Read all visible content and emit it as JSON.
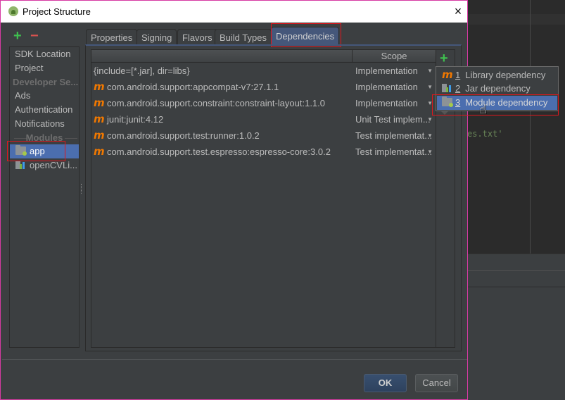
{
  "background_editor": {
    "code_fragment": "es.txt'"
  },
  "dialog": {
    "title": "Project Structure",
    "close_icon": "×",
    "toolbar": {
      "add_icon": "+",
      "remove_icon": "−"
    },
    "sidebar": {
      "items": [
        {
          "label": "SDK Location",
          "type": "item"
        },
        {
          "label": "Project",
          "type": "item"
        },
        {
          "label": "Developer Se...",
          "type": "header"
        },
        {
          "label": "Ads",
          "type": "item"
        },
        {
          "label": "Authentication",
          "type": "item"
        },
        {
          "label": "Notifications",
          "type": "item"
        },
        {
          "label": "Modules",
          "type": "separator"
        },
        {
          "label": "app",
          "type": "module",
          "icon": "module-folder-icon",
          "selected": true
        },
        {
          "label": "openCVLi...",
          "type": "module",
          "icon": "library-module-icon",
          "selected": false
        }
      ]
    },
    "tabs": [
      {
        "label": "Properties",
        "active": false
      },
      {
        "label": "Signing",
        "active": false
      },
      {
        "label": "Flavors",
        "active": false
      },
      {
        "label": "Build Types",
        "active": false
      },
      {
        "label": "Dependencies",
        "active": true
      }
    ],
    "dependencies_table": {
      "columns": [
        "",
        "Scope"
      ],
      "rows": [
        {
          "name": "{include=[*.jar], dir=libs}",
          "icon": "",
          "scope": "Implementation"
        },
        {
          "name": "com.android.support:appcompat-v7:27.1.1",
          "icon": "maven-icon",
          "scope": "Implementation"
        },
        {
          "name": "com.android.support.constraint:constraint-layout:1.1.0",
          "icon": "maven-icon",
          "scope": "Implementation"
        },
        {
          "name": "junit:junit:4.12",
          "icon": "maven-icon",
          "scope": "Unit Test implem..."
        },
        {
          "name": "com.android.support.test:runner:1.0.2",
          "icon": "maven-icon",
          "scope": "Test implementat..."
        },
        {
          "name": "com.android.support.test.espresso:espresso-core:3.0.2",
          "icon": "maven-icon",
          "scope": "Test implementat..."
        }
      ],
      "maven_glyph": "m",
      "dropdown_glyph": "▼"
    },
    "add_dependency_icon": "+",
    "add_menu": {
      "items": [
        {
          "mnemonic": "1",
          "label": "Library dependency",
          "icon": "maven-icon",
          "selected": false
        },
        {
          "mnemonic": "2",
          "label": "Jar dependency",
          "icon": "jar-icon",
          "selected": false
        },
        {
          "mnemonic": "3",
          "label": "Module dependency",
          "icon": "module-folder-icon",
          "selected": true
        }
      ]
    },
    "buttons": {
      "ok": "OK",
      "cancel": "Cancel"
    },
    "cursor_glyph": "☝"
  }
}
